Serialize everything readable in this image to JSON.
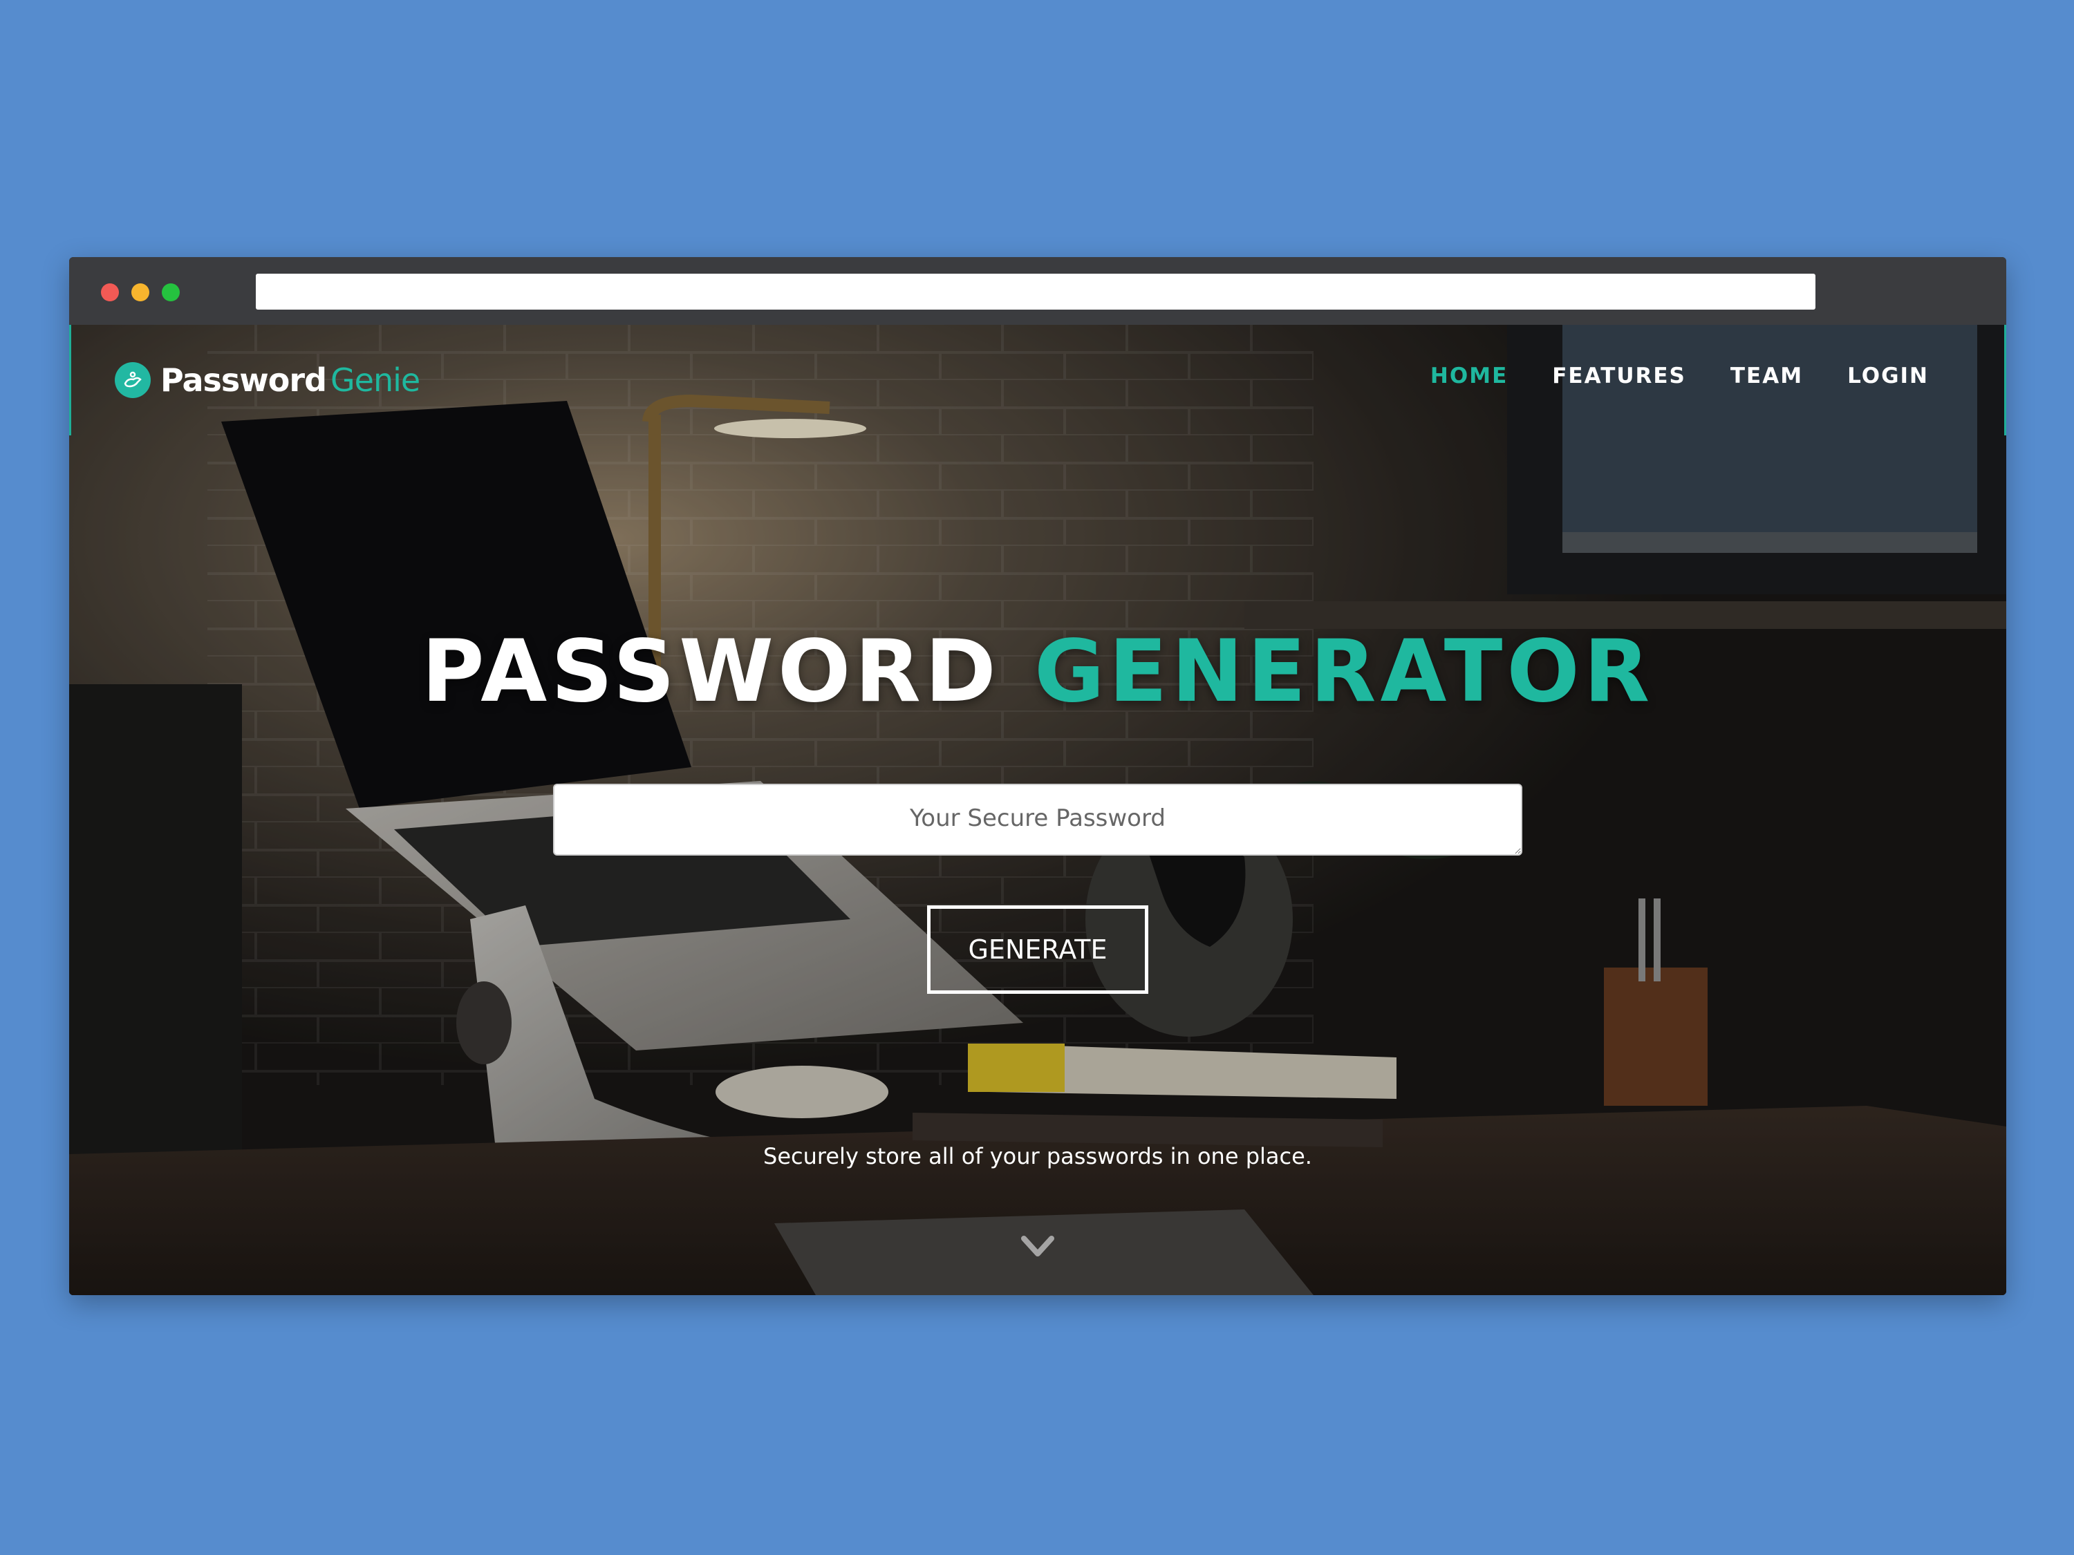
{
  "colors": {
    "background": "#568cce",
    "accent": "#1fb89f",
    "chrome": "#3b3c3f",
    "white": "#ffffff"
  },
  "brand": {
    "name": "Password",
    "accent": "Genie",
    "logo_icon": "genie-lamp-icon"
  },
  "nav": {
    "items": [
      {
        "label": "HOME",
        "active": true
      },
      {
        "label": "FEATURES",
        "active": false
      },
      {
        "label": "TEAM",
        "active": false
      },
      {
        "label": "LOGIN",
        "active": false
      }
    ]
  },
  "hero": {
    "title_part1": "PASSWORD",
    "title_part2": "GENERATOR",
    "input_placeholder": "Your Secure Password",
    "input_value": "",
    "button_label": "GENERATE",
    "tagline": "Securely store all of your passwords in one place.",
    "scroll_icon": "chevron-down-icon"
  }
}
